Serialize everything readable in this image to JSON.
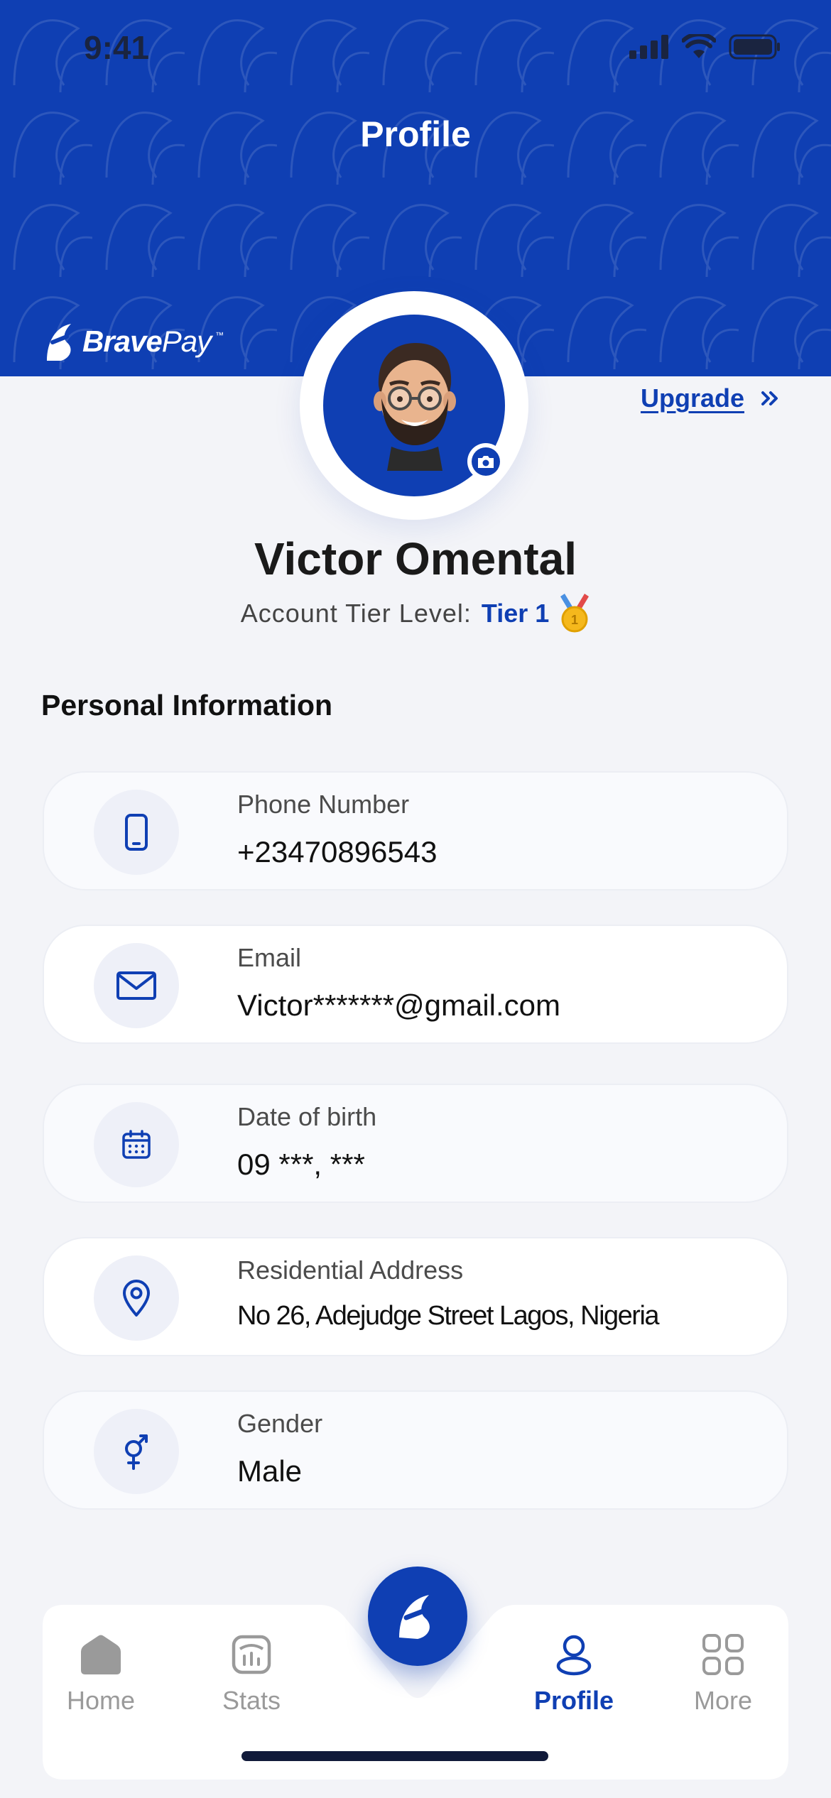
{
  "status_bar": {
    "time": "9:41"
  },
  "header": {
    "title": "Profile"
  },
  "brand": {
    "name_bold": "Brave",
    "name_light": "Pay",
    "tm": "™"
  },
  "upgrade": {
    "label": "Upgrade"
  },
  "user": {
    "name": "Victor Omental",
    "tier_label": "Account Tier Level:",
    "tier_value": "Tier 1",
    "tier_badge_icon": "gold-medal-icon"
  },
  "section": {
    "title": "Personal Information"
  },
  "info_items": [
    {
      "label": "Phone Number",
      "value": "+23470896543",
      "icon": "phone-icon"
    },
    {
      "label": "Email",
      "value": "Victor*******@gmail.com",
      "icon": "mail-icon"
    },
    {
      "label": "Date of birth",
      "value": "09 ***, ***",
      "icon": "calendar-icon"
    },
    {
      "label": "Residential Address",
      "value": "No 26, Adejudge Street Lagos, Nigeria",
      "icon": "location-pin-icon"
    },
    {
      "label": "Gender",
      "value": "Male",
      "icon": "gender-icon"
    }
  ],
  "nav": {
    "items": [
      {
        "label": "Home",
        "icon": "home-icon"
      },
      {
        "label": "Stats",
        "icon": "stats-icon"
      },
      {
        "label": "Profile",
        "icon": "profile-icon",
        "active": true
      },
      {
        "label": "More",
        "icon": "grid-icon"
      }
    ]
  },
  "colors": {
    "primary": "#0f3fb3",
    "background": "#f3f4f8",
    "card": "#ffffff",
    "muted": "#9a9a9a"
  }
}
